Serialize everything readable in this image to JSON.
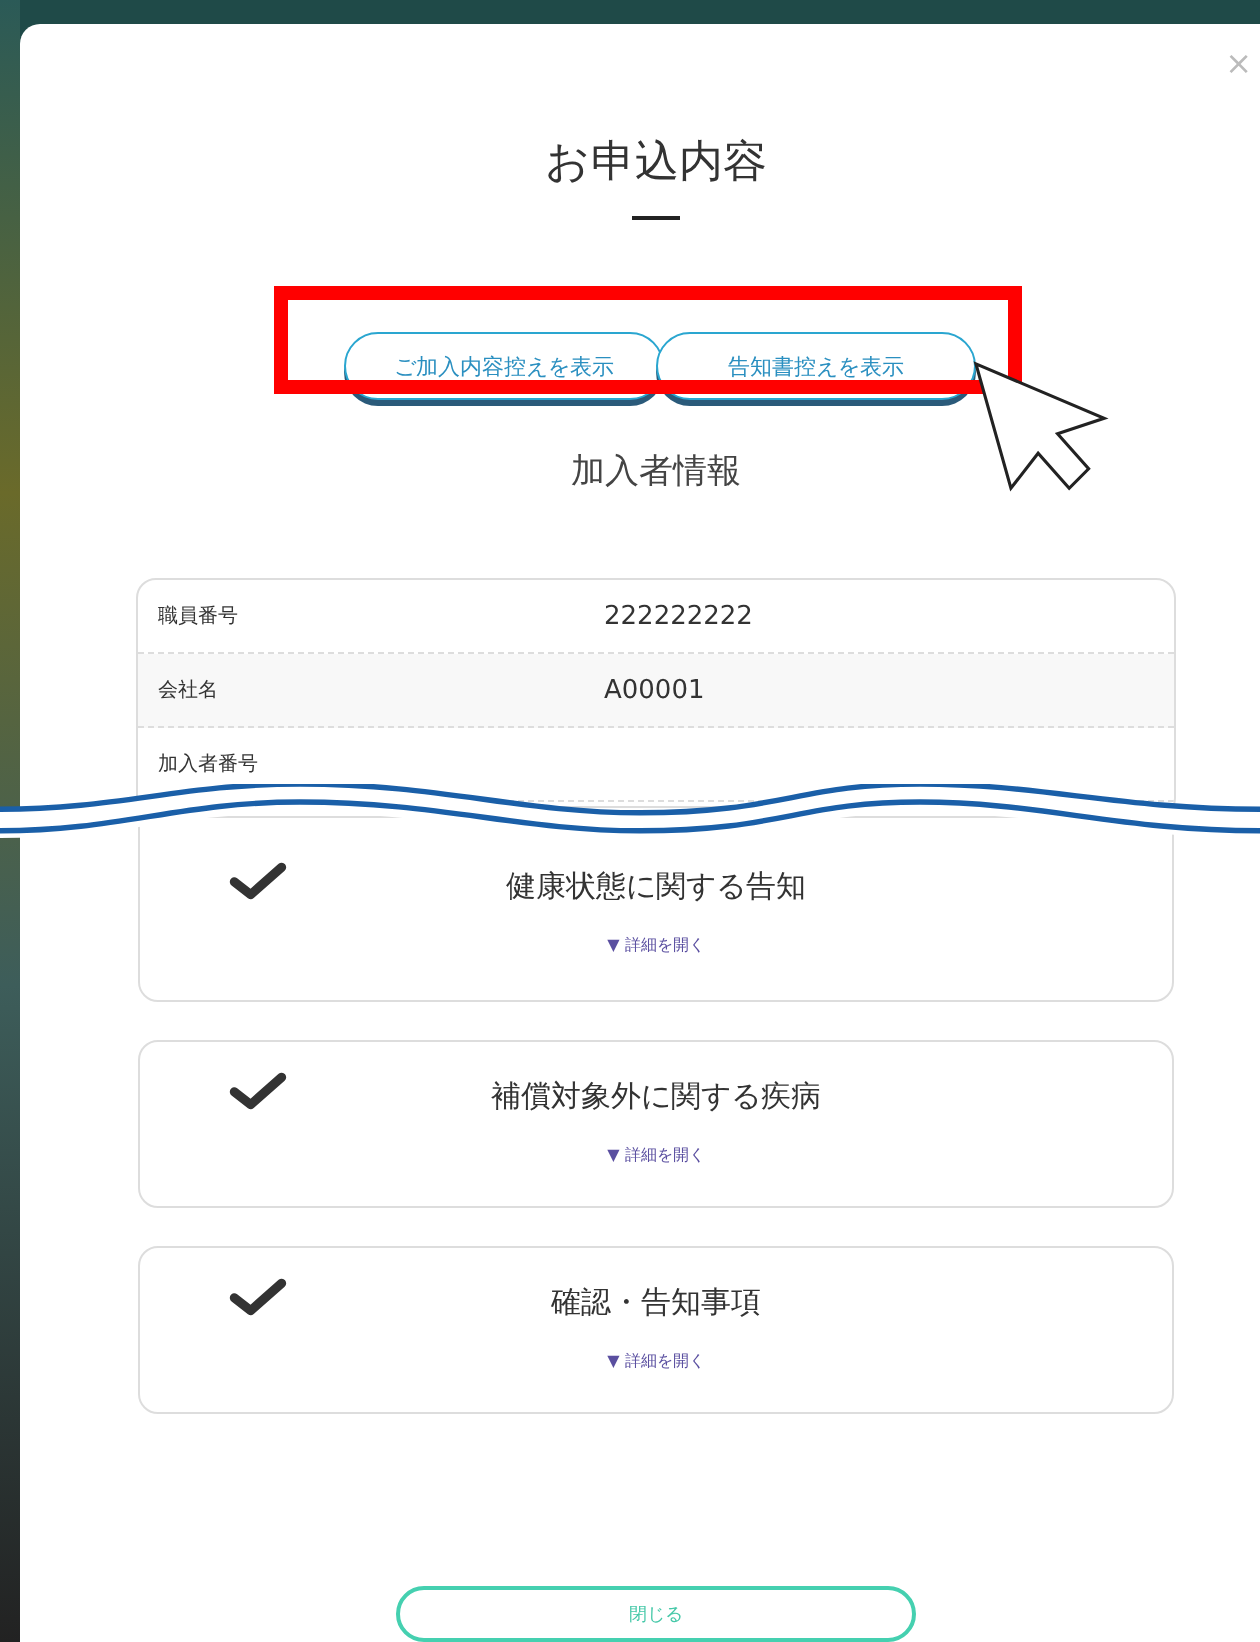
{
  "dialog": {
    "close_icon": "×",
    "title": "お申込内容"
  },
  "action_buttons": [
    "ご加入内容控えを表示",
    "告知書控えを表示"
  ],
  "section_heading": "加入者情報",
  "info_rows": [
    {
      "label": "職員番号",
      "value": "222222222"
    },
    {
      "label": "会社名",
      "value": "A00001"
    },
    {
      "label": "加入者番号"
    }
  ],
  "sections": [
    {
      "title": "健康状態に関する告知",
      "checked": true,
      "toggle": "▼ 詳細を開く"
    },
    {
      "title": "補償対象外に関する疾病",
      "checked": true,
      "toggle": "▼ 詳細を開く"
    },
    {
      "title": "確認・告知事項",
      "checked": true,
      "toggle": "▼ 詳細を開く"
    }
  ],
  "close_button": "閉じる"
}
